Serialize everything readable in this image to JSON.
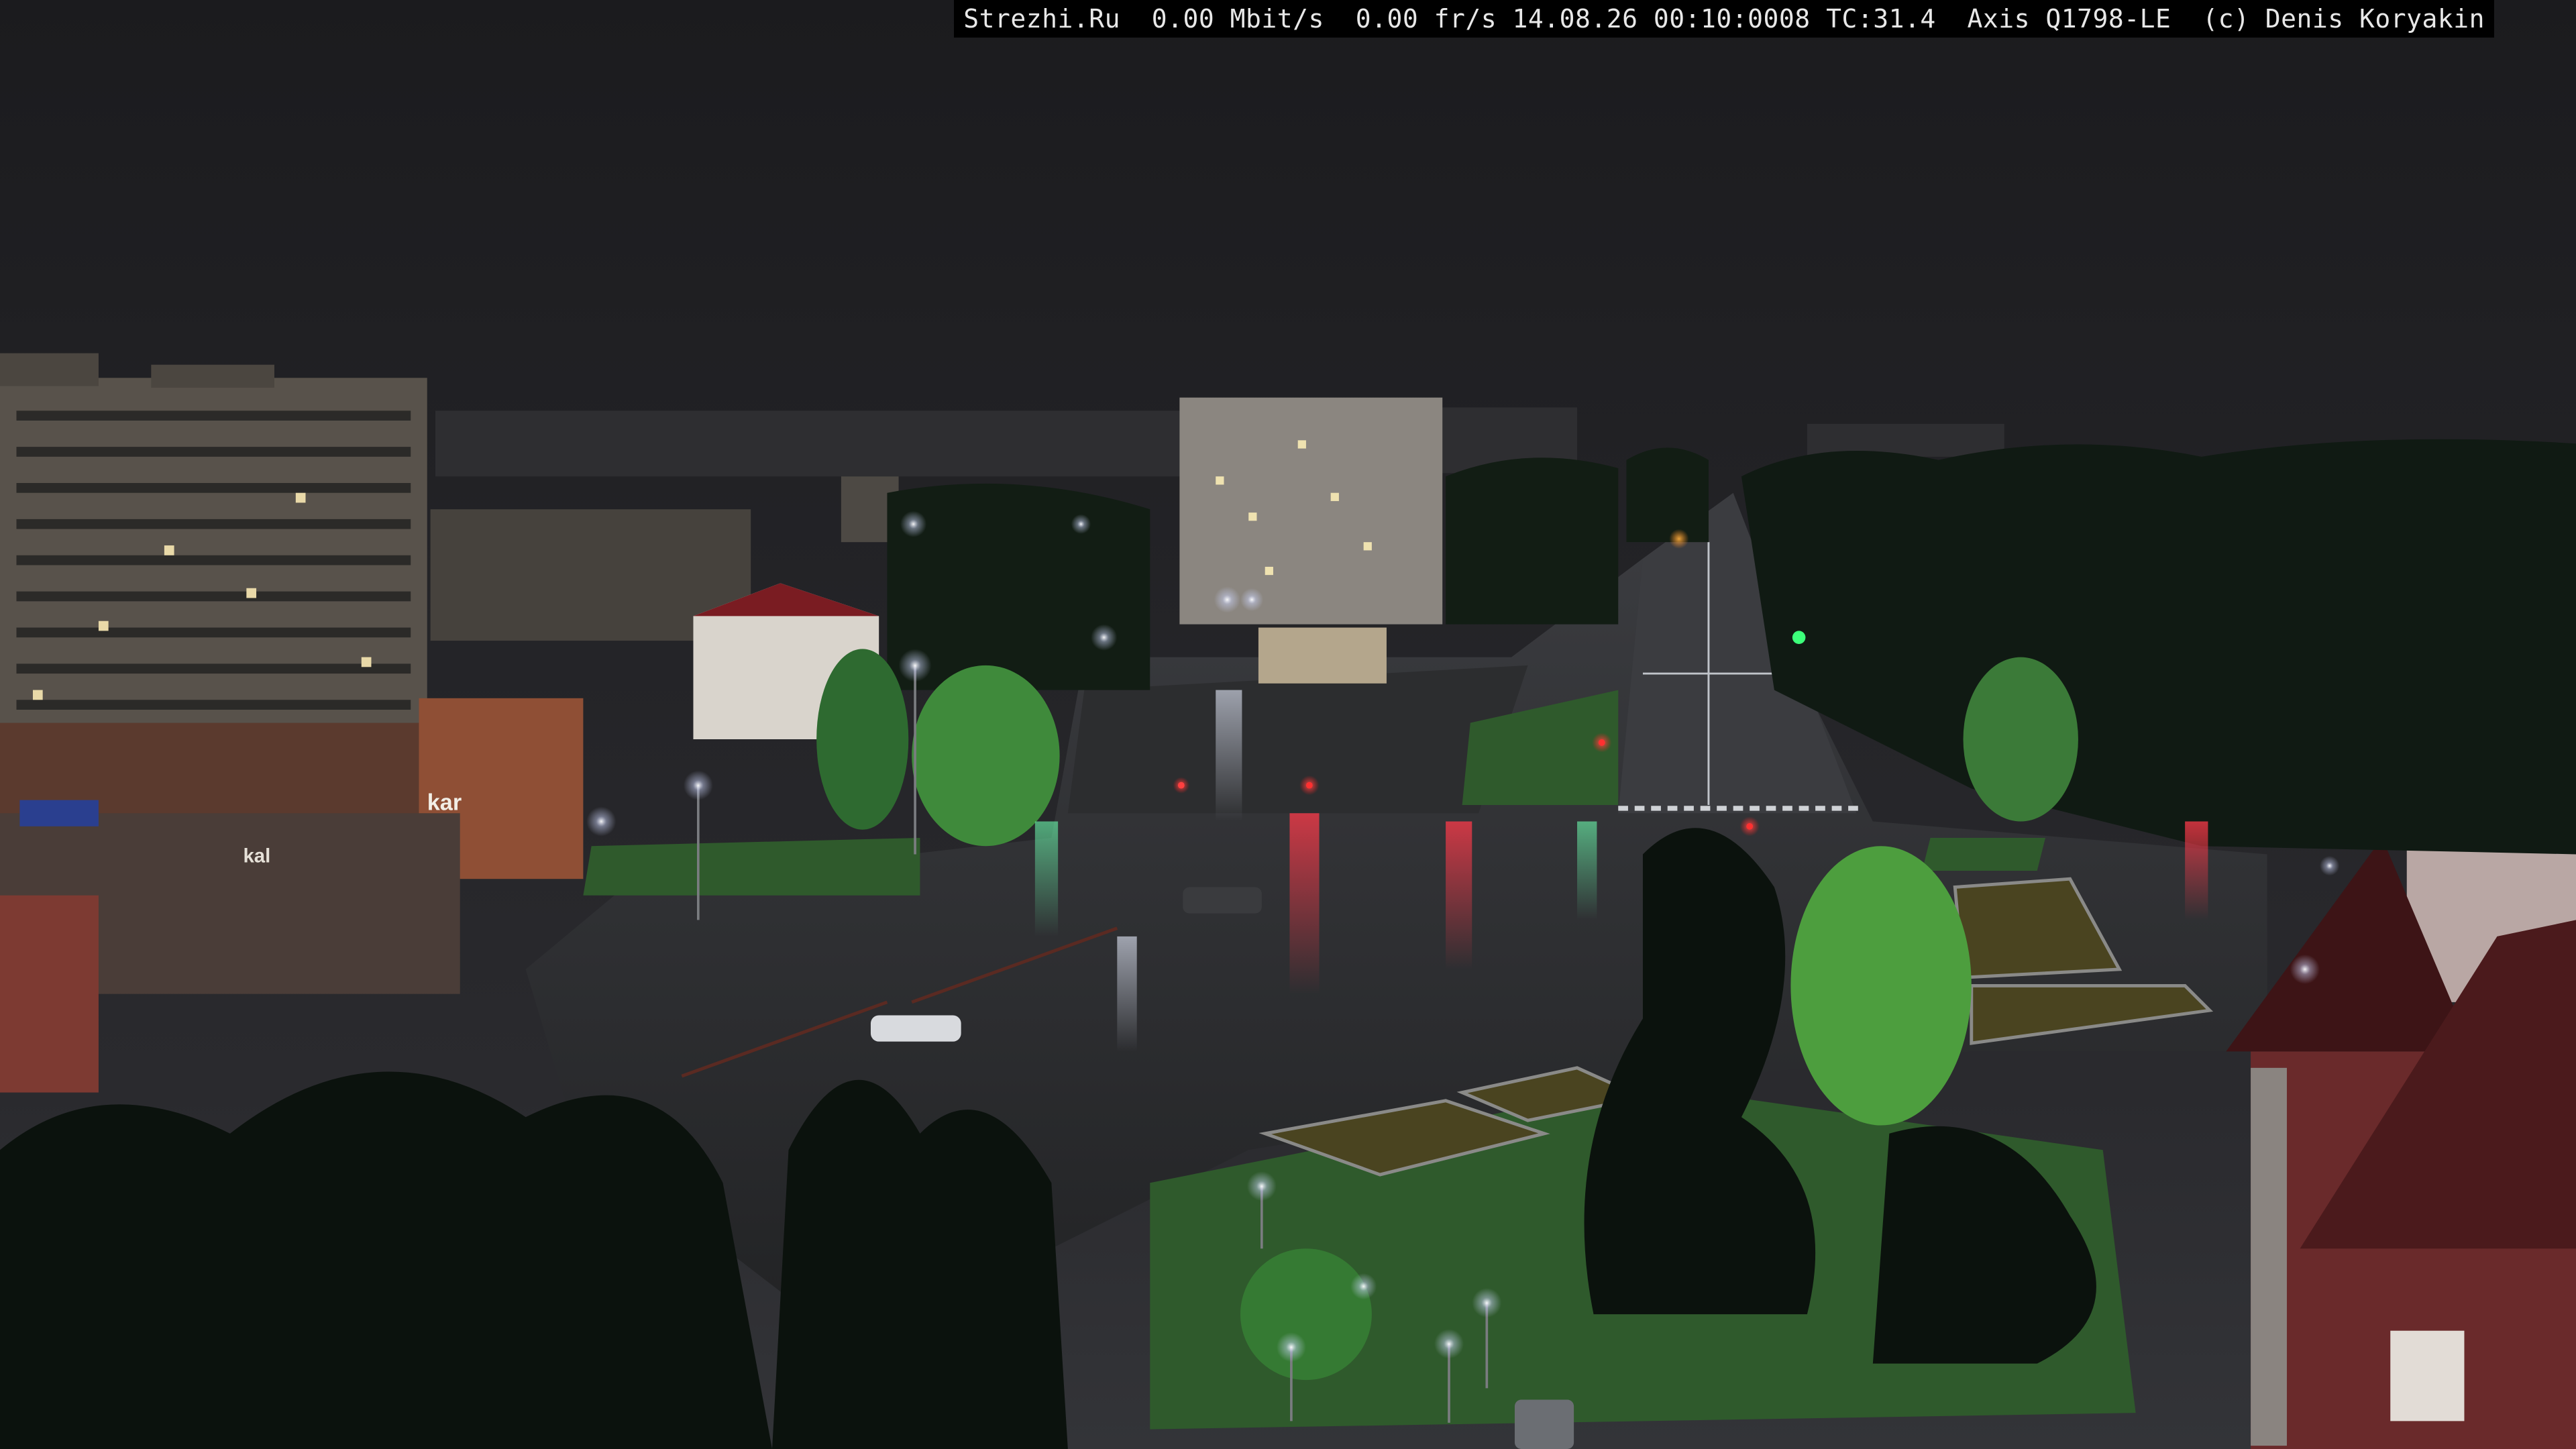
{
  "overlay": {
    "site": "Strezhi.Ru",
    "bitrate": "0.00 Mbit/s",
    "framerate": "0.00 fr/s",
    "datetime": "14.08.26 00:10:0008",
    "temperature": "TC:31.4",
    "camera_model": "Axis Q1798-LE",
    "copyright": "(c) Denis Koryakin"
  },
  "signs": {
    "shop_left": "kar",
    "shop_small": "kal"
  },
  "colors": {
    "sky": "#1e1e21",
    "road_wet": "#2a2b2d",
    "grass": "#3f7a3a",
    "tree_dark": "#0d150f",
    "tree_lit": "#5fae45",
    "building": "#5a524a",
    "street_light": "#dfe6ff",
    "traffic_red": "#ff2a2a",
    "traffic_green": "#3cff7a"
  }
}
